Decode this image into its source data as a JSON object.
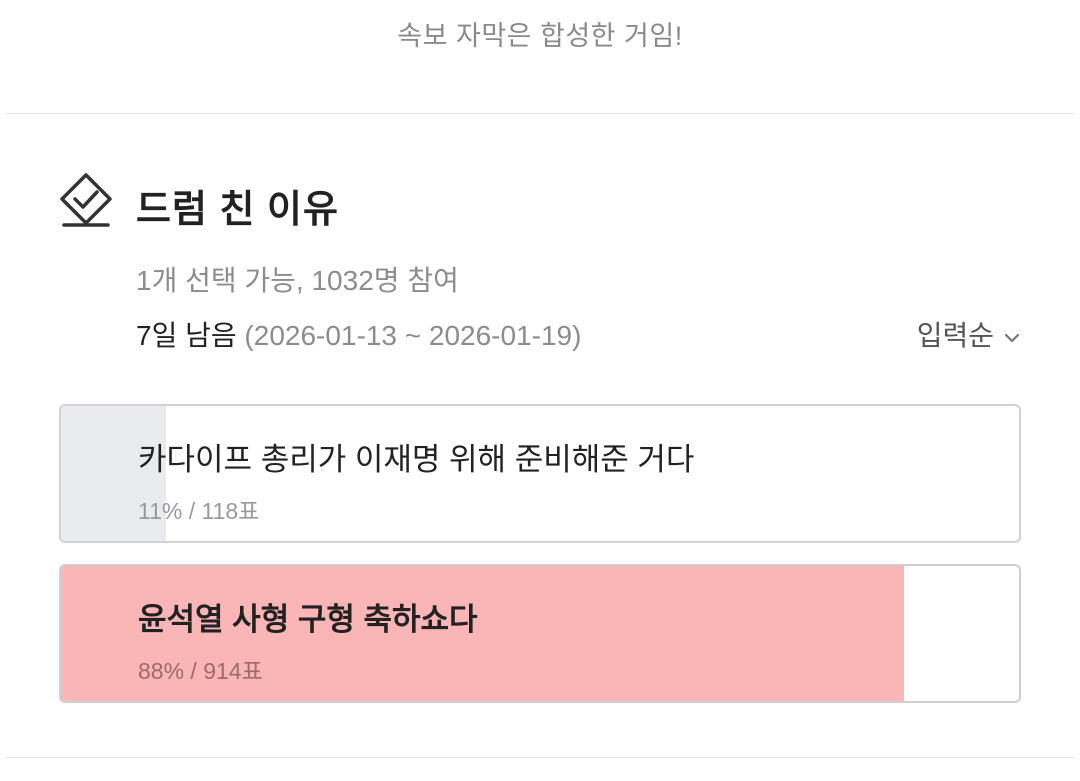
{
  "caption": "속보 자막은 합성한 거임!",
  "poll": {
    "title": "드럼 친 이유",
    "meta": "1개 선택 가능, 1032명 참여",
    "remaining": "7일 남음",
    "period": " (2026-01-13 ~ 2026-01-19)",
    "sort_label": "입력순",
    "icon": "ballot-check-icon",
    "options": [
      {
        "text": "카다이프 총리가 이재명 위해 준비해준 거다",
        "stat": "11% / 118표",
        "percent": 11,
        "fill_color": "#e9ebee"
      },
      {
        "text": "윤석열 사형 구형 축하쇼다",
        "stat": "88% / 914표",
        "percent": 88,
        "fill_color": "#fab5b6"
      }
    ]
  }
}
